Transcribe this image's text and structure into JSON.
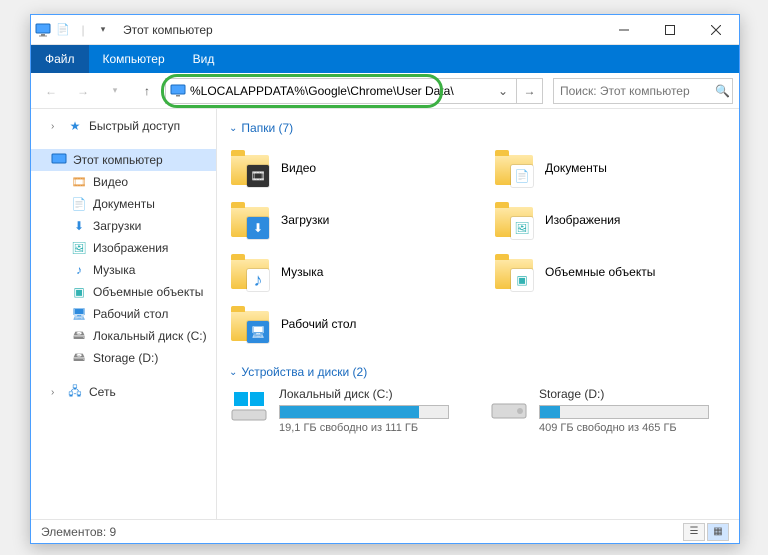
{
  "titlebar": {
    "title": "Этот компьютер"
  },
  "menubar": {
    "file": "Файл",
    "computer": "Компьютер",
    "view": "Вид"
  },
  "addressbar": {
    "path": "%LOCALAPPDATA%\\Google\\Chrome\\User Data\\"
  },
  "searchbox": {
    "placeholder": "Поиск: Этот компьютер"
  },
  "sidebar": {
    "quick_access": "Быстрый доступ",
    "this_pc": "Этот компьютер",
    "videos": "Видео",
    "documents": "Документы",
    "downloads": "Загрузки",
    "pictures": "Изображения",
    "music": "Музыка",
    "objects3d": "Объемные объекты",
    "desktop": "Рабочий стол",
    "local_disk": "Локальный диск (C:)",
    "storage": "Storage (D:)",
    "network": "Сеть"
  },
  "groups": {
    "folders_label": "Папки (7)",
    "drives_label": "Устройства и диски (2)"
  },
  "folders": {
    "videos": "Видео",
    "documents": "Документы",
    "downloads": "Загрузки",
    "pictures": "Изображения",
    "music": "Музыка",
    "objects3d": "Объемные объекты",
    "desktop": "Рабочий стол"
  },
  "drives": {
    "c": {
      "name": "Локальный диск (C:)",
      "stats": "19,1 ГБ свободно из 111 ГБ",
      "fill_pct": 83
    },
    "d": {
      "name": "Storage (D:)",
      "stats": "409 ГБ свободно из 465 ГБ",
      "fill_pct": 12
    }
  },
  "statusbar": {
    "text": "Элементов: 9"
  }
}
